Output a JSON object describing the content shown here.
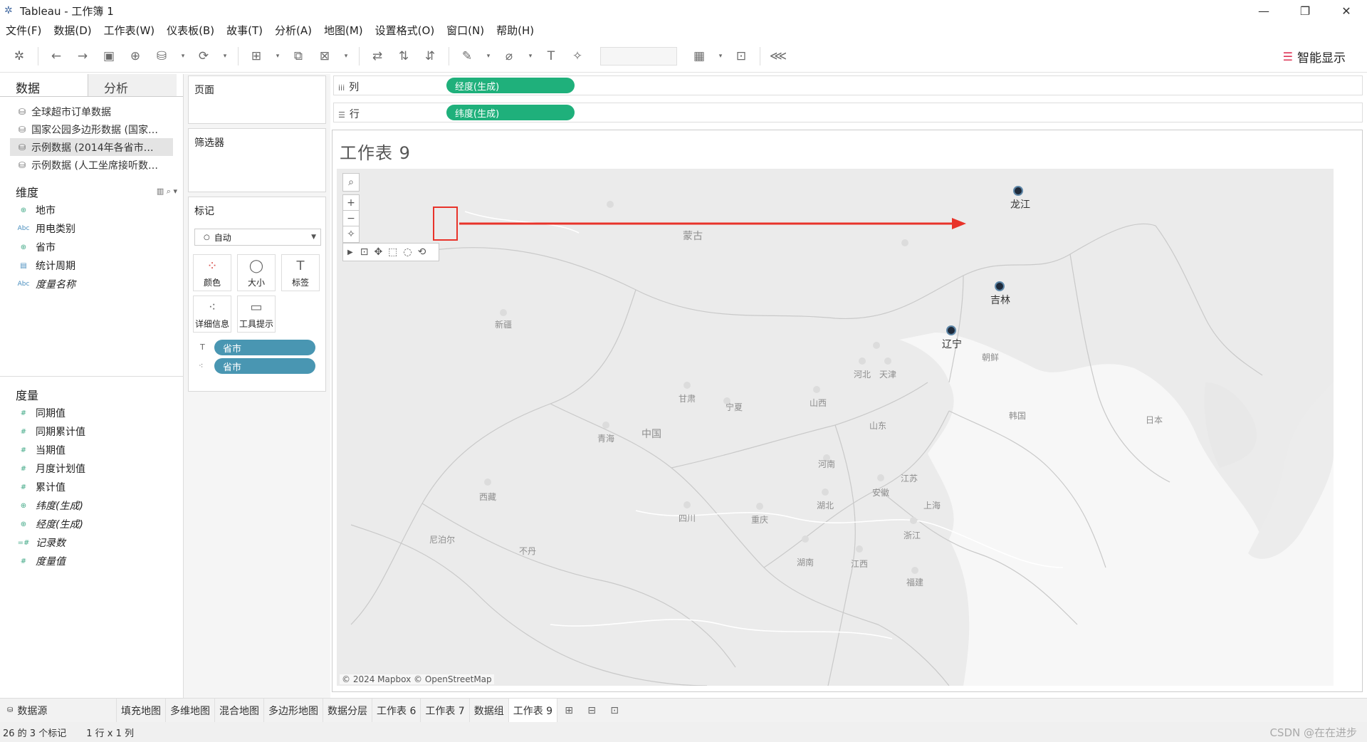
{
  "window": {
    "title": "Tableau - 工作簿 1"
  },
  "menu": [
    "文件(F)",
    "数据(D)",
    "工作表(W)",
    "仪表板(B)",
    "故事(T)",
    "分析(A)",
    "地图(M)",
    "设置格式(O)",
    "窗口(N)",
    "帮助(H)"
  ],
  "toolbar": {
    "smart_show": "智能显示"
  },
  "datapane": {
    "tabs": [
      "数据",
      "分析"
    ],
    "datasources": [
      "全球超市订单数据",
      "国家公园多边形数据 (国家…",
      "示例数据 (2014年各省市…",
      "示例数据 (人工坐席接听数…"
    ],
    "dimensions_label": "维度",
    "dimensions": [
      "地市",
      "用电类别",
      "省市",
      "统计周期",
      "度量名称"
    ],
    "measures_label": "度量",
    "measures": [
      "同期值",
      "同期累计值",
      "当期值",
      "月度计划值",
      "累计值",
      "纬度(生成)",
      "经度(生成)",
      "记录数",
      "度量值"
    ]
  },
  "shelves": {
    "pages_label": "页面",
    "filters_label": "筛选器",
    "marks_label": "标记",
    "marks_type": "自动",
    "mark_buttons": [
      "颜色",
      "大小",
      "标签",
      "详细信息",
      "工具提示"
    ],
    "mark_pills": [
      "省市",
      "省市"
    ],
    "columns_label": "列",
    "rows_label": "行",
    "columns_pill": "经度(生成)",
    "rows_pill": "纬度(生成)"
  },
  "viz": {
    "title": "工作表 9",
    "credit": "© 2024 Mapbox © OpenStreetMap",
    "points": [
      {
        "label": "龙江"
      },
      {
        "label": "吉林"
      },
      {
        "label": "辽宁"
      }
    ],
    "base_labels": [
      "蒙古",
      "新疆",
      "甘肃",
      "宁夏",
      "中国",
      "青海",
      "西藏",
      "四川",
      "重庆",
      "河北",
      "天津",
      "山西",
      "山东",
      "河南",
      "江苏",
      "安徽",
      "湖北",
      "上海",
      "浙江",
      "湖南",
      "江西",
      "福建",
      "朝鲜",
      "韩国",
      "日本",
      "尼泊尔",
      "不丹"
    ]
  },
  "sheets": {
    "datasource": "数据源",
    "tabs": [
      "填充地图",
      "多维地图",
      "混合地图",
      "多边形地图",
      "数据分层",
      "工作表 6",
      "工作表 7",
      "数据组",
      "工作表 9"
    ],
    "active": "工作表 9"
  },
  "status": {
    "marks": "26 的 3 个标记",
    "grid": "1 行 x 1 列"
  },
  "watermark": "CSDN @在在进步",
  "colors": {
    "pill_green": "#1fb07b",
    "pill_blue": "#4996b2",
    "annotation_red": "#e8332a"
  }
}
